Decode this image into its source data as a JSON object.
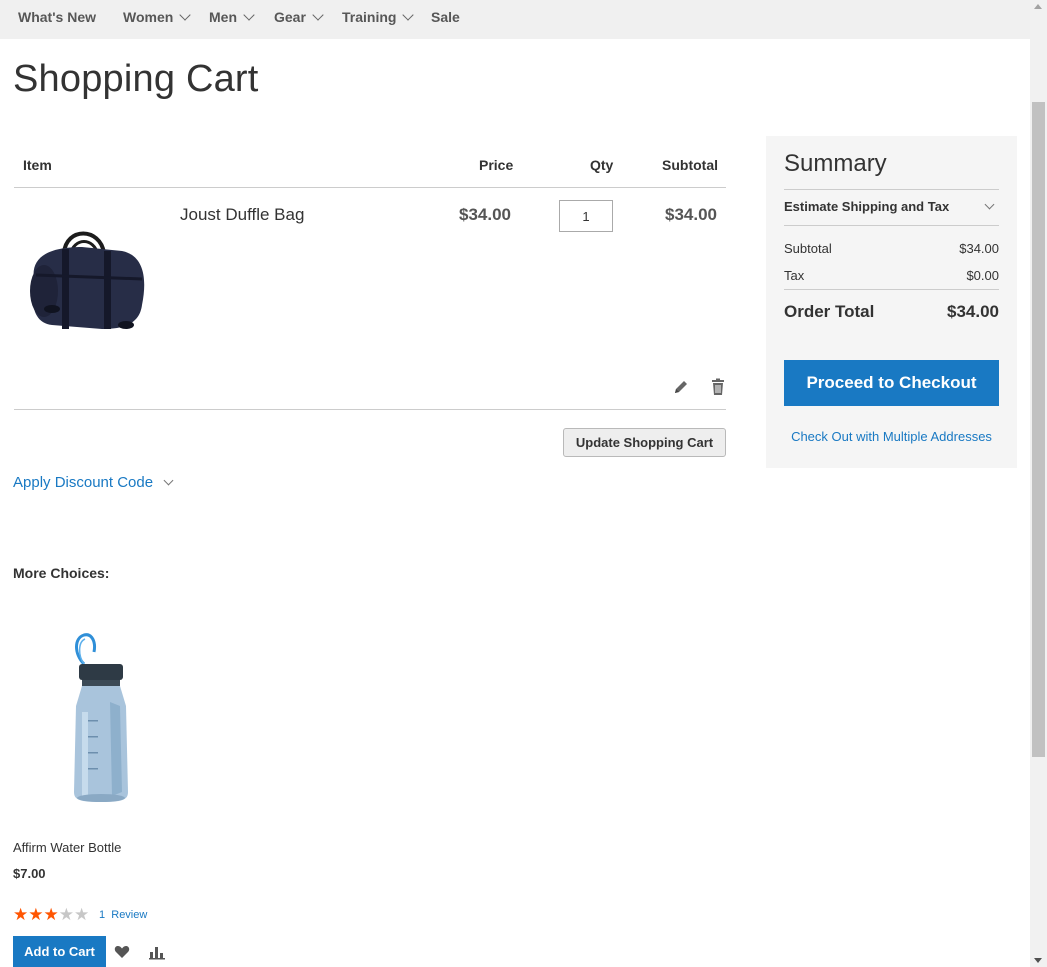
{
  "nav": {
    "items": [
      {
        "label": "What's New",
        "has_menu": false
      },
      {
        "label": "Women",
        "has_menu": true
      },
      {
        "label": "Men",
        "has_menu": true
      },
      {
        "label": "Gear",
        "has_menu": true
      },
      {
        "label": "Training",
        "has_menu": true
      },
      {
        "label": "Sale",
        "has_menu": false
      }
    ]
  },
  "page": {
    "title": "Shopping Cart"
  },
  "cart": {
    "headers": {
      "item": "Item",
      "price": "Price",
      "qty": "Qty",
      "subtotal": "Subtotal"
    },
    "items": [
      {
        "name": "Joust Duffle Bag",
        "price": "$34.00",
        "qty": "1",
        "subtotal": "$34.00",
        "image_icon": "duffle-bag"
      }
    ],
    "update_button": "Update Shopping Cart",
    "discount_label": "Apply Discount Code"
  },
  "summary": {
    "title": "Summary",
    "estimate_label": "Estimate Shipping and Tax",
    "subtotal_label": "Subtotal",
    "subtotal_value": "$34.00",
    "tax_label": "Tax",
    "tax_value": "$0.00",
    "total_label": "Order Total",
    "total_value": "$34.00",
    "checkout_button": "Proceed to Checkout",
    "multi_address_link": "Check Out with Multiple Addresses"
  },
  "more_choices": {
    "title": "More Choices:",
    "products": [
      {
        "name": "Affirm Water Bottle",
        "price": "$7.00",
        "rating": 3,
        "rating_max": 5,
        "review_count": "1",
        "review_label": "Review",
        "add_button": "Add to Cart",
        "image_icon": "water-bottle"
      }
    ]
  },
  "colors": {
    "accent": "#1979c3",
    "star_filled": "#ff5501",
    "star_empty": "#c7c7c7",
    "nav_bg": "#f0f0f0",
    "summary_bg": "#f5f5f5"
  }
}
